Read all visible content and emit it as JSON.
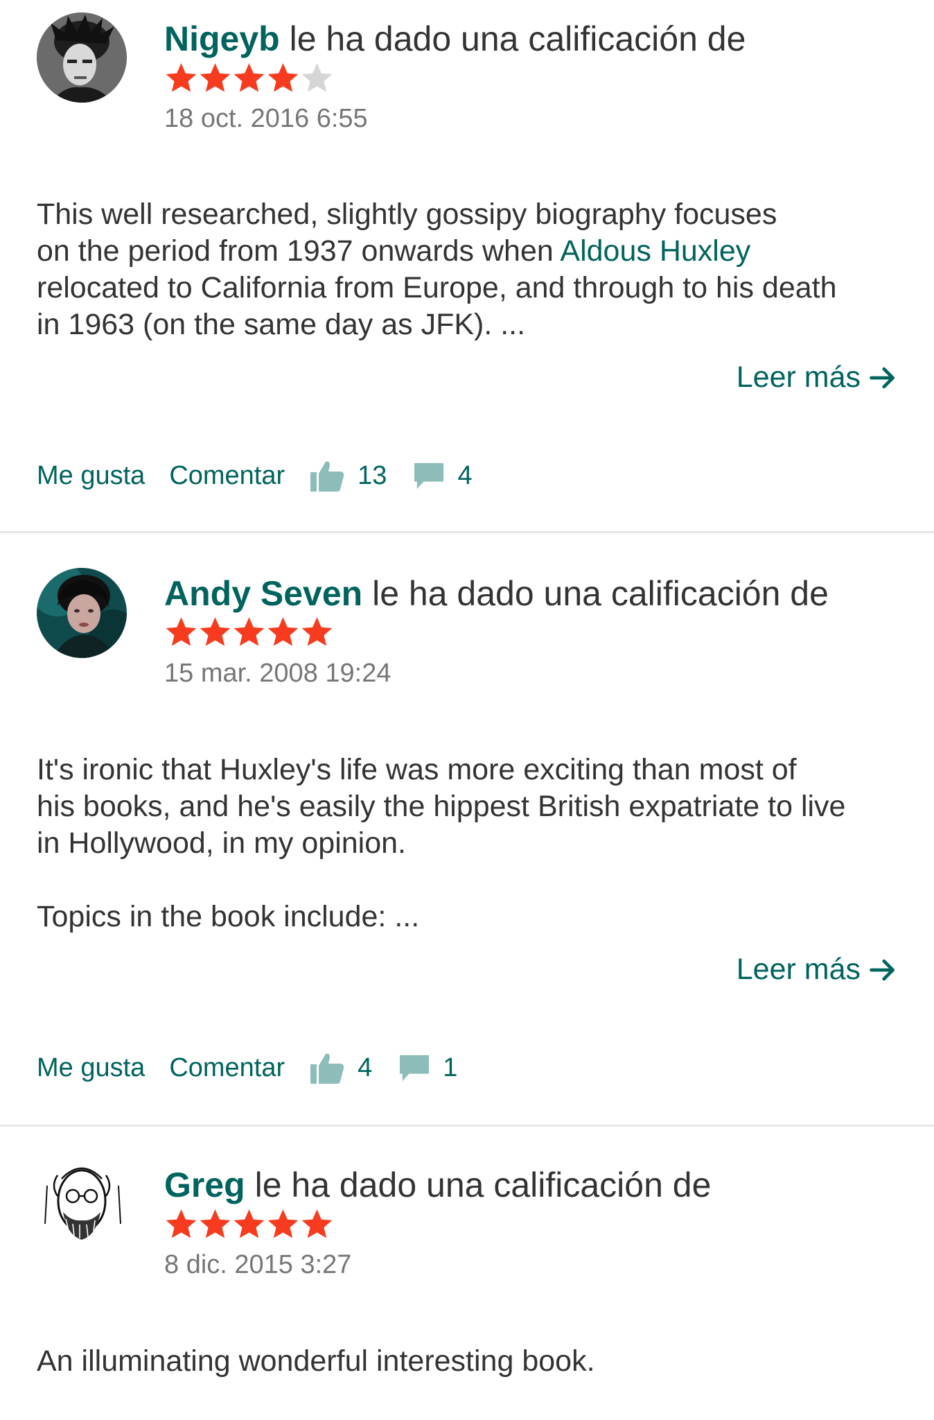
{
  "colors": {
    "brand_green": "#00635d",
    "star_filled": "#f63b1e",
    "star_empty": "#d6d6d6",
    "icon_teal": "#8dbdb8",
    "divider": "#e6e6e6"
  },
  "reviews": [
    {
      "user": "Nigeyb",
      "headline_suffix": " le ha dado una calificación de",
      "rating": 4,
      "rating_max": 5,
      "date": "18 oct. 2016 6:55",
      "body": {
        "line1": "This well researched, slightly gossipy biography focuses",
        "line2_pre": "on the period from 1937 onwards when ",
        "line2_link": "Aldous Huxley",
        "line3": "relocated to California from Europe, and through to his death",
        "line4": "in 1963 (on the same day as JFK). ..."
      },
      "read_more": "Leer más",
      "like_label": "Me gusta",
      "comment_label": "Comentar",
      "likes": "13",
      "comments": "4",
      "avatar_icon": "user-avatar-icon"
    },
    {
      "user": "Andy Seven",
      "headline_suffix": " le ha dado una calificación de",
      "rating": 5,
      "rating_max": 5,
      "date": "15 mar. 2008 19:24",
      "body": {
        "line1": "It's ironic that Huxley's life was more exciting than most of",
        "line2": "his books, and he's easily the hippest British expatriate to live",
        "line3": "in Hollywood, in my opinion.",
        "line4": "Topics in the book include: ..."
      },
      "read_more": "Leer más",
      "like_label": "Me gusta",
      "comment_label": "Comentar",
      "likes": "4",
      "comments": "1",
      "avatar_icon": "user-avatar-icon"
    },
    {
      "user": "Greg",
      "headline_suffix": " le ha dado una calificación de",
      "rating": 5,
      "rating_max": 5,
      "date": "8 dic. 2015 3:27",
      "body": {
        "line1": "An illuminating wonderful interesting book."
      },
      "avatar_icon": "user-avatar-icon"
    }
  ]
}
